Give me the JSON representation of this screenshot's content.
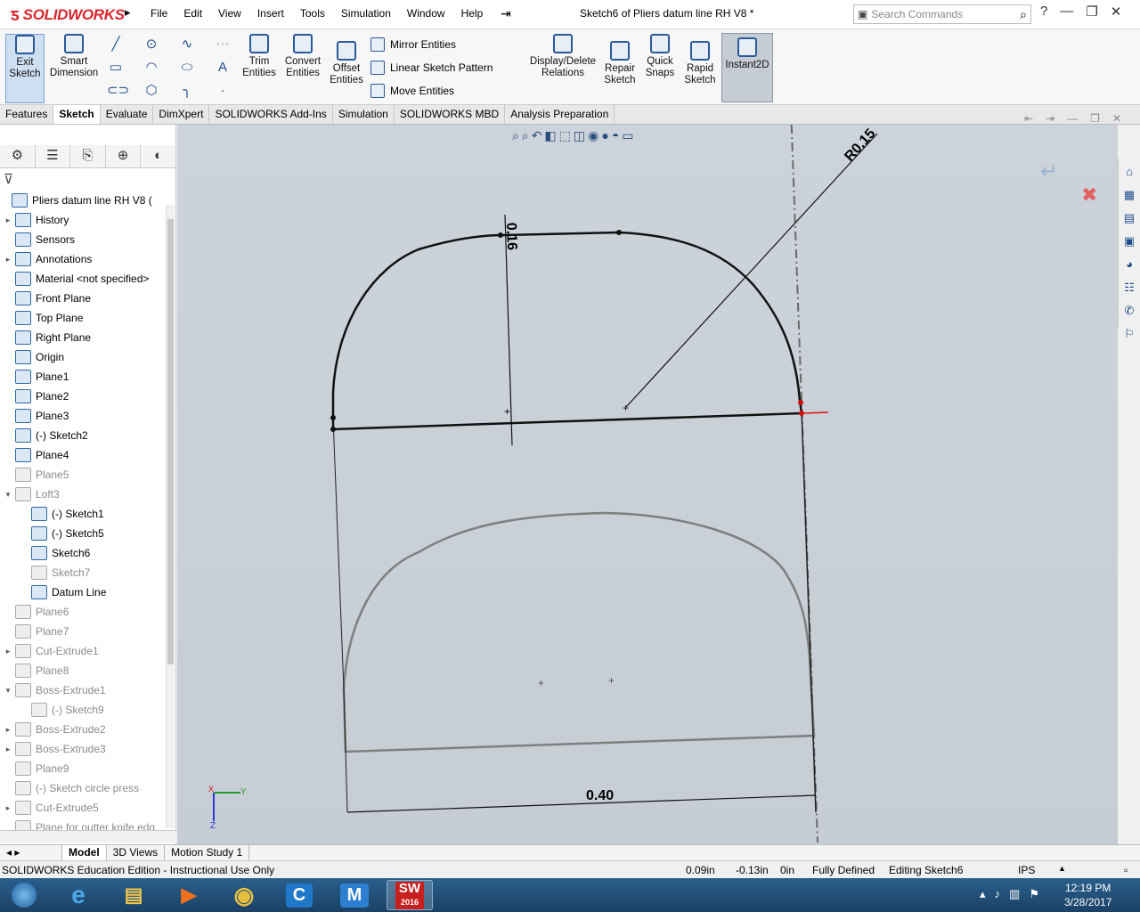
{
  "app": {
    "logo": "SOLIDWORKS",
    "doc_title": "Sketch6 of Pliers datum line RH V8 *"
  },
  "menu": [
    "File",
    "Edit",
    "View",
    "Insert",
    "Tools",
    "Simulation",
    "Window",
    "Help"
  ],
  "search": {
    "placeholder": "Search Commands"
  },
  "toolbar": {
    "exit_sketch": "Exit Sketch",
    "smart_dimension": "Smart Dimension",
    "trim_entities": "Trim Entities",
    "convert_entities": "Convert Entities",
    "offset_entities": "Offset Entities",
    "mirror_entities": "Mirror Entities",
    "linear_sketch_pattern": "Linear Sketch Pattern",
    "move_entities": "Move Entities",
    "display_delete_relations": "Display/Delete Relations",
    "repair_sketch": "Repair Sketch",
    "quick_snaps": "Quick Snaps",
    "rapid_sketch": "Rapid Sketch",
    "instant2d": "Instant2D"
  },
  "tabs": [
    "Features",
    "Sketch",
    "Evaluate",
    "DimXpert",
    "SOLIDWORKS Add-Ins",
    "Simulation",
    "SOLIDWORKS MBD",
    "Analysis Preparation"
  ],
  "active_tab": "Sketch",
  "tree": [
    {
      "label": "Pliers datum line RH V8  (",
      "indent": 0,
      "dim": false,
      "expand": ""
    },
    {
      "label": "History",
      "indent": 1,
      "dim": false,
      "expand": "▸"
    },
    {
      "label": "Sensors",
      "indent": 1,
      "dim": false,
      "expand": ""
    },
    {
      "label": "Annotations",
      "indent": 1,
      "dim": false,
      "expand": "▸"
    },
    {
      "label": "Material <not specified>",
      "indent": 1,
      "dim": false,
      "expand": ""
    },
    {
      "label": "Front Plane",
      "indent": 1,
      "dim": false,
      "expand": ""
    },
    {
      "label": "Top Plane",
      "indent": 1,
      "dim": false,
      "expand": ""
    },
    {
      "label": "Right Plane",
      "indent": 1,
      "dim": false,
      "expand": ""
    },
    {
      "label": "Origin",
      "indent": 1,
      "dim": false,
      "expand": ""
    },
    {
      "label": "Plane1",
      "indent": 1,
      "dim": false,
      "expand": ""
    },
    {
      "label": "Plane2",
      "indent": 1,
      "dim": false,
      "expand": ""
    },
    {
      "label": "Plane3",
      "indent": 1,
      "dim": false,
      "expand": ""
    },
    {
      "label": "(-) Sketch2",
      "indent": 1,
      "dim": false,
      "expand": ""
    },
    {
      "label": "Plane4",
      "indent": 1,
      "dim": false,
      "expand": ""
    },
    {
      "label": "Plane5",
      "indent": 1,
      "dim": true,
      "expand": ""
    },
    {
      "label": "Loft3",
      "indent": 1,
      "dim": true,
      "expand": "▾"
    },
    {
      "label": "(-) Sketch1",
      "indent": 2,
      "dim": false,
      "expand": ""
    },
    {
      "label": "(-) Sketch5",
      "indent": 2,
      "dim": false,
      "expand": ""
    },
    {
      "label": "Sketch6",
      "indent": 2,
      "dim": false,
      "expand": ""
    },
    {
      "label": "Sketch7",
      "indent": 2,
      "dim": true,
      "expand": ""
    },
    {
      "label": "Datum Line",
      "indent": 2,
      "dim": false,
      "expand": ""
    },
    {
      "label": "Plane6",
      "indent": 1,
      "dim": true,
      "expand": ""
    },
    {
      "label": "Plane7",
      "indent": 1,
      "dim": true,
      "expand": ""
    },
    {
      "label": "Cut-Extrude1",
      "indent": 1,
      "dim": true,
      "expand": "▸"
    },
    {
      "label": "Plane8",
      "indent": 1,
      "dim": true,
      "expand": ""
    },
    {
      "label": "Boss-Extrude1",
      "indent": 1,
      "dim": true,
      "expand": "▾"
    },
    {
      "label": "(-) Sketch9",
      "indent": 2,
      "dim": true,
      "expand": ""
    },
    {
      "label": "Boss-Extrude2",
      "indent": 1,
      "dim": true,
      "expand": "▸"
    },
    {
      "label": "Boss-Extrude3",
      "indent": 1,
      "dim": true,
      "expand": "▸"
    },
    {
      "label": "Plane9",
      "indent": 1,
      "dim": true,
      "expand": ""
    },
    {
      "label": "(-) Sketch circle press",
      "indent": 1,
      "dim": true,
      "expand": ""
    },
    {
      "label": "Cut-Extrude5",
      "indent": 1,
      "dim": true,
      "expand": "▸"
    },
    {
      "label": "Plane for outter knife edg",
      "indent": 1,
      "dim": true,
      "expand": ""
    }
  ],
  "dimensions": {
    "radius": "R0.15",
    "height": "0.16",
    "width": "0.40"
  },
  "axis": {
    "x": "X",
    "y": "Y",
    "z": "Z"
  },
  "bottom_tabs": [
    "Model",
    "3D Views",
    "Motion Study 1"
  ],
  "active_bottom_tab": "Model",
  "status": {
    "edition": "SOLIDWORKS Education Edition - Instructional Use Only",
    "x": "0.09in",
    "y": "-0.13in",
    "z": "0in",
    "state": "Fully Defined",
    "editing": "Editing Sketch6",
    "units": "IPS"
  },
  "taskbar": {
    "time": "12:19 PM",
    "date": "3/28/2017",
    "sw_year": "2016"
  }
}
